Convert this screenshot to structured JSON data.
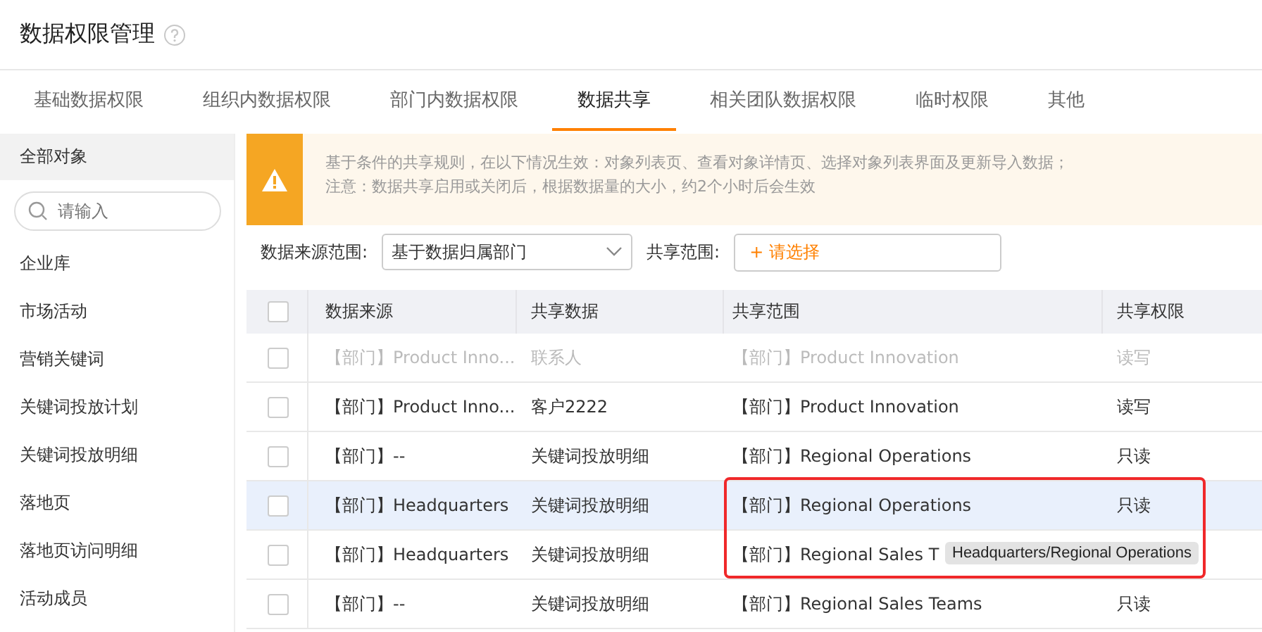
{
  "page": {
    "title": "数据权限管理"
  },
  "tabs": [
    {
      "label": "基础数据权限",
      "selected": false
    },
    {
      "label": "组织内数据权限",
      "selected": false
    },
    {
      "label": "部门内数据权限",
      "selected": false
    },
    {
      "label": "数据共享",
      "selected": true
    },
    {
      "label": "相关团队数据权限",
      "selected": false
    },
    {
      "label": "临时权限",
      "selected": false
    },
    {
      "label": "其他",
      "selected": false
    }
  ],
  "sidebar": {
    "header": "全部对象",
    "search": {
      "placeholder": "请输入"
    },
    "items": [
      "企业库",
      "市场活动",
      "营销关键词",
      "关键词投放计划",
      "关键词投放明细",
      "落地页",
      "落地页访问明细",
      "活动成员"
    ]
  },
  "notice": {
    "lines": [
      "基于条件的共享规则，在以下情况生效：对象列表页、查看对象详情页、选择对象列表界面及更新导入数据；",
      "注意：数据共享启用或关闭后，根据数据量的大小，约2个小时后会生效"
    ]
  },
  "filters": {
    "source_label": "数据来源范围:",
    "source_value": "基于数据归属部门",
    "scope_label": "共享范围:",
    "scope_button": "+ 请选择"
  },
  "table": {
    "header_checked": false,
    "columns": [
      "数据来源",
      "共享数据",
      "共享范围",
      "共享权限"
    ],
    "rows": [
      {
        "cells": [
          "【部门】Product Inno...",
          "联系人",
          "【部门】Product Innovation",
          "读写"
        ],
        "checked": false,
        "disabled": true,
        "highlighted": false
      },
      {
        "cells": [
          "【部门】Product Inno...",
          "客户2222",
          "【部门】Product Innovation",
          "读写"
        ],
        "checked": false,
        "disabled": false,
        "highlighted": false
      },
      {
        "cells": [
          "【部门】--",
          "关键词投放明细",
          "【部门】Regional Operations",
          "只读"
        ],
        "checked": false,
        "disabled": false,
        "highlighted": false
      },
      {
        "cells": [
          "【部门】Headquarters",
          "关键词投放明细",
          "【部门】Regional Operations",
          "只读"
        ],
        "checked": false,
        "disabled": false,
        "highlighted": true
      },
      {
        "cells": [
          "【部门】Headquarters",
          "关键词投放明细",
          "【部门】Regional Sales T",
          ""
        ],
        "checked": false,
        "disabled": false,
        "highlighted": false
      },
      {
        "cells": [
          "【部门】--",
          "关键词投放明细",
          "【部门】Regional Sales Teams",
          "只读"
        ],
        "checked": false,
        "disabled": false,
        "highlighted": false
      }
    ]
  },
  "tooltip": "Headquarters/Regional Operations"
}
